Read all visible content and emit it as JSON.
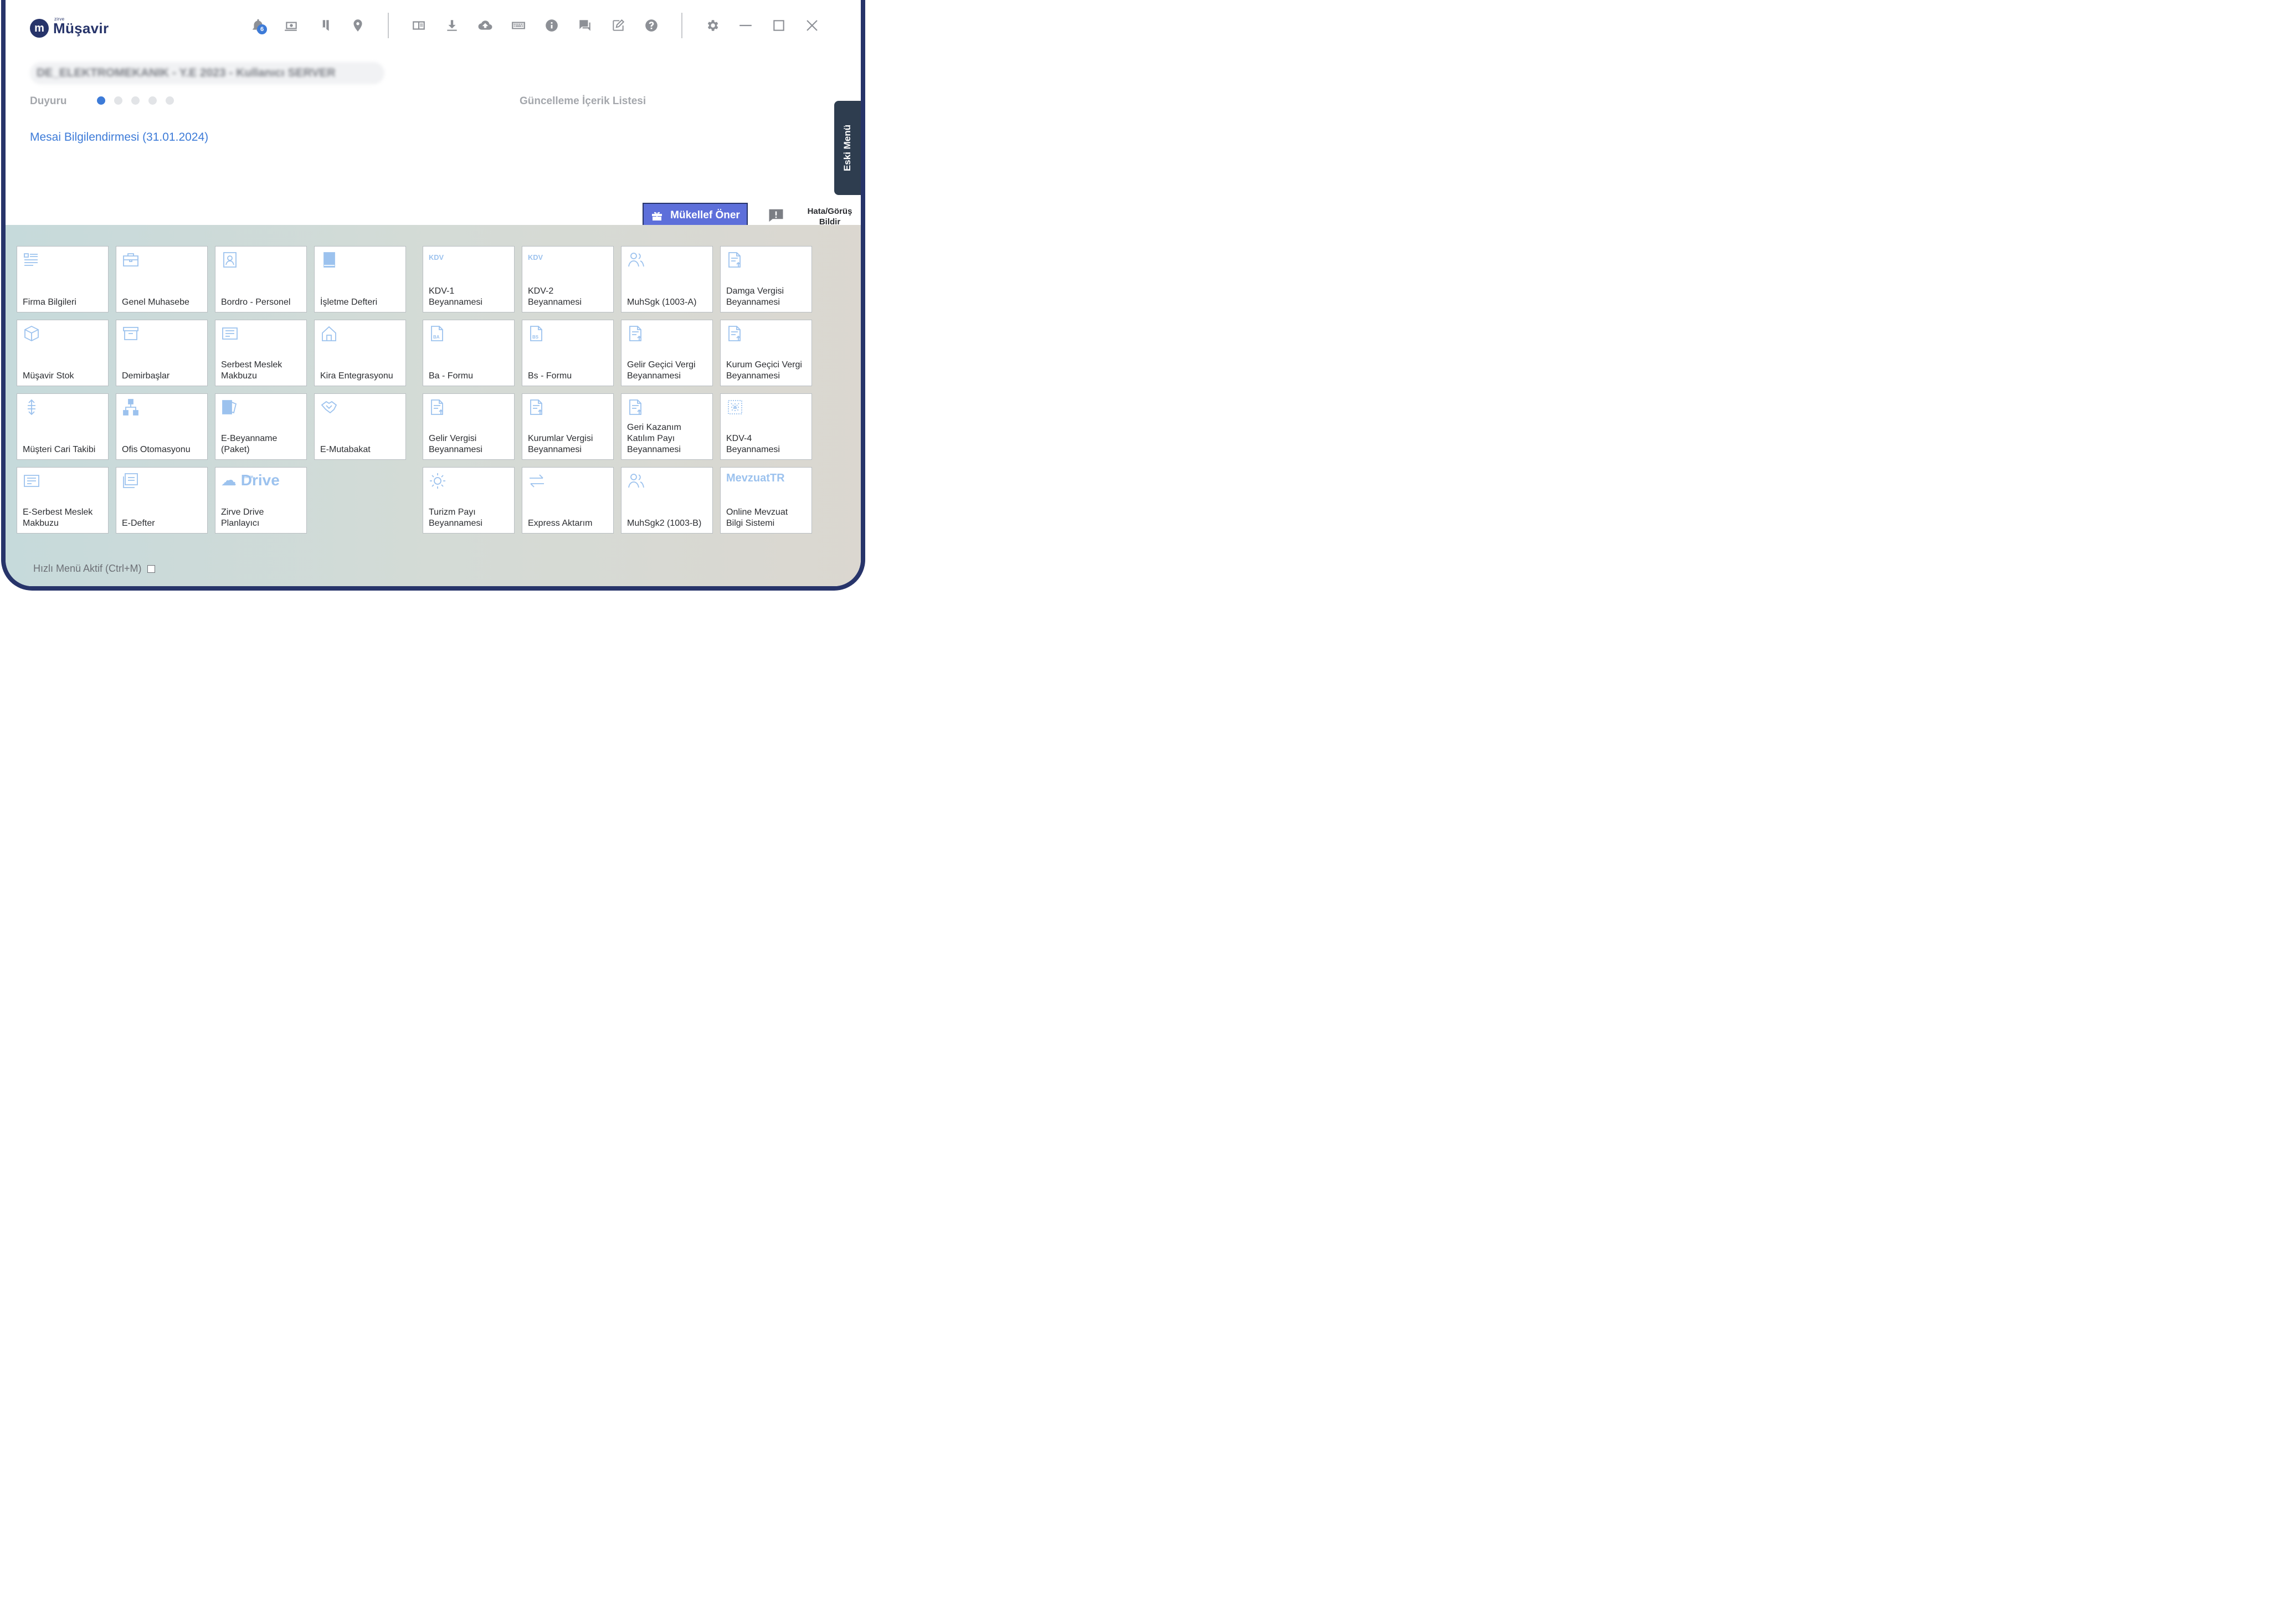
{
  "app": {
    "logo_mark": "m",
    "logo_sup": "zirve",
    "logo_text": "Müşavir"
  },
  "toolbar": {
    "notification_count": "6",
    "icons": [
      "bell-icon",
      "money-icon",
      "bookmark-icon",
      "location-icon",
      "reader-icon",
      "download-icon",
      "cloud-upload-icon",
      "keyboard-icon",
      "info-icon",
      "chat-icon",
      "edit-icon",
      "help-icon",
      "gear-icon",
      "minimize-icon",
      "maximize-icon",
      "close-icon"
    ]
  },
  "session": {
    "info": "DE_ELEKTROMEKANIK - Y.E 2023 - Kullanıcı SERVER"
  },
  "announcements": {
    "label": "Duyuru",
    "active_index": 0,
    "dot_count": 5,
    "item_title": "Mesai Bilgilendirmesi (31.01.2024)",
    "update_list_label": "Güncelleme İçerik Listesi"
  },
  "side": {
    "eski_menu": "Eski Menü"
  },
  "actions": {
    "suggest_label": "Mükellef Öner",
    "feedback_label": "Hata/Görüş\nBildir"
  },
  "tiles_left": [
    {
      "label": "Firma Bilgileri",
      "icon": "list-icon"
    },
    {
      "label": "Genel Muhasebe",
      "icon": "briefcase-icon"
    },
    {
      "label": "Bordro - Personel",
      "icon": "person-card-icon"
    },
    {
      "label": "İşletme Defteri",
      "icon": "book-icon"
    },
    {
      "label": "Müşavir Stok",
      "icon": "cube-icon"
    },
    {
      "label": "Demirbaşlar",
      "icon": "archive-icon"
    },
    {
      "label": "Serbest Meslek\nMakbuzu",
      "icon": "receipt-icon"
    },
    {
      "label": "Kira Entegrasyonu",
      "icon": "house-icon"
    },
    {
      "label": "Müşteri Cari Takibi",
      "icon": "vertical-arrows-icon"
    },
    {
      "label": "Ofis Otomasyonu",
      "icon": "org-chart-icon"
    },
    {
      "label": "E-Beyanname\n(Paket)",
      "icon": "package-icon"
    },
    {
      "label": "E-Mutabakat",
      "icon": "handshake-icon"
    },
    {
      "label": "E-Serbest Meslek\nMakbuzu",
      "icon": "receipt-icon"
    },
    {
      "label": "E-Defter",
      "icon": "ledger-icon"
    },
    {
      "label": "Zirve Drive\nPlanlayıcı",
      "icon": "drive-logo-icon",
      "logo_text": "Drive",
      "logo_sup": "zirve"
    }
  ],
  "tiles_right": [
    {
      "label": "KDV-1\nBeyannamesi",
      "icon": "kdv-icon",
      "logo_text": "KDV"
    },
    {
      "label": "KDV-2\nBeyannamesi",
      "icon": "kdv-icon",
      "logo_text": "KDV"
    },
    {
      "label": "MuhSgk (1003-A)",
      "icon": "people-icon"
    },
    {
      "label": "Damga Vergisi\nBeyannamesi",
      "icon": "document-upload-icon"
    },
    {
      "label": "Ba - Formu",
      "icon": "ba-document-icon",
      "logo_text": "BA"
    },
    {
      "label": "Bs - Formu",
      "icon": "bs-document-icon",
      "logo_text": "BS"
    },
    {
      "label": "Gelir Geçici Vergi\nBeyannamesi",
      "icon": "document-upload-icon"
    },
    {
      "label": "Kurum Geçici Vergi\nBeyannamesi",
      "icon": "document-upload-icon"
    },
    {
      "label": "Gelir Vergisi\nBeyannamesi",
      "icon": "document-upload-icon"
    },
    {
      "label": "Kurumlar Vergisi\nBeyannamesi",
      "icon": "document-upload-icon"
    },
    {
      "label": "Geri Kazanım\nKatılım Payı\nBeyannamesi",
      "icon": "document-upload-icon"
    },
    {
      "label": "KDV-4\nBeyannamesi",
      "icon": "grid-box-icon"
    },
    {
      "label": "Turizm Payı\nBeyannamesi",
      "icon": "sun-icon"
    },
    {
      "label": "Express Aktarım",
      "icon": "transfer-arrows-icon"
    },
    {
      "label": "MuhSgk2 (1003-B)",
      "icon": "people-icon"
    },
    {
      "label": "Online Mevzuat\nBilgi Sistemi",
      "icon": "mevzuattr-logo-icon",
      "logo_text": "MevzuatTR"
    }
  ],
  "footer": {
    "quick_menu_label": "Hızlı Menü Aktif (Ctrl+M)",
    "quick_menu_checked": false
  },
  "colors": {
    "brand": "#27346a",
    "accent": "#3d7bd8",
    "button": "#5d6fda",
    "tile_icon": "#9cc2ee",
    "side_tab": "#2e3d4f"
  }
}
